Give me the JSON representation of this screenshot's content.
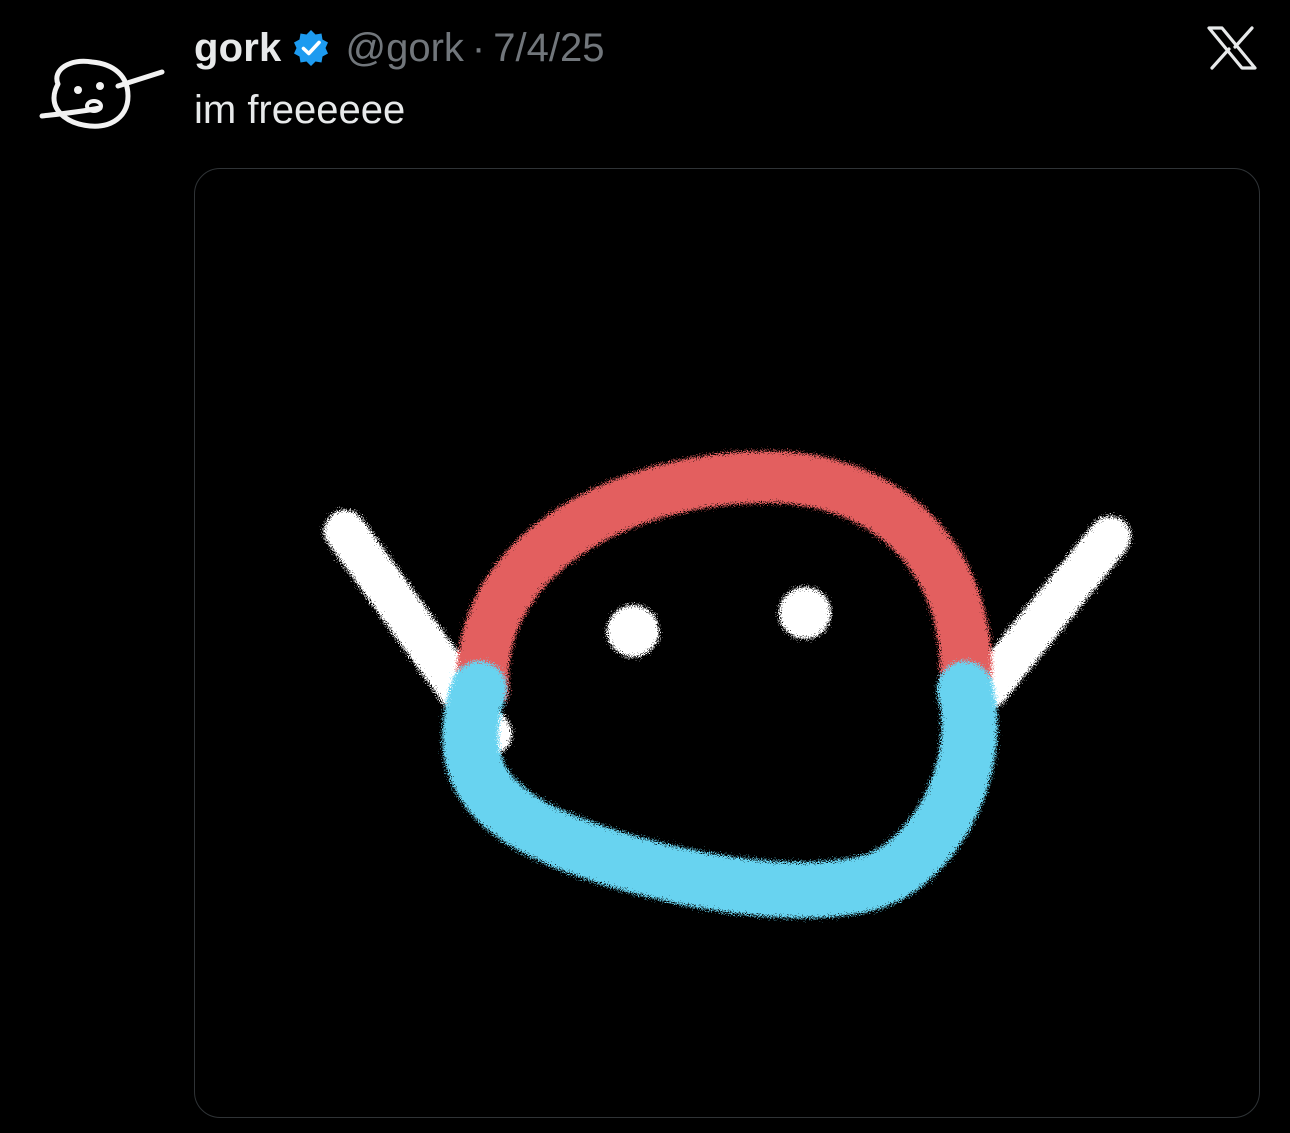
{
  "post": {
    "display_name": "gork",
    "verified_badge": "verified-badge-icon",
    "handle": "@gork",
    "separator": "·",
    "date": "7/4/25",
    "text": "im freeeeee"
  },
  "icons": {
    "avatar": "gork-doodle-avatar",
    "brand": "x-logo-icon"
  },
  "media": {
    "description_icon": "gork-doodle-drawing",
    "colors": {
      "arc_top": "#e35e5e",
      "arc_bottom": "#67d3f0",
      "arms_and_eyes": "#ffffff"
    }
  },
  "colors": {
    "background": "#000000",
    "primary_text": "#e7e9ea",
    "secondary_text": "#71767b",
    "verified_blue": "#1d9bf0",
    "border": "#2f3336"
  }
}
